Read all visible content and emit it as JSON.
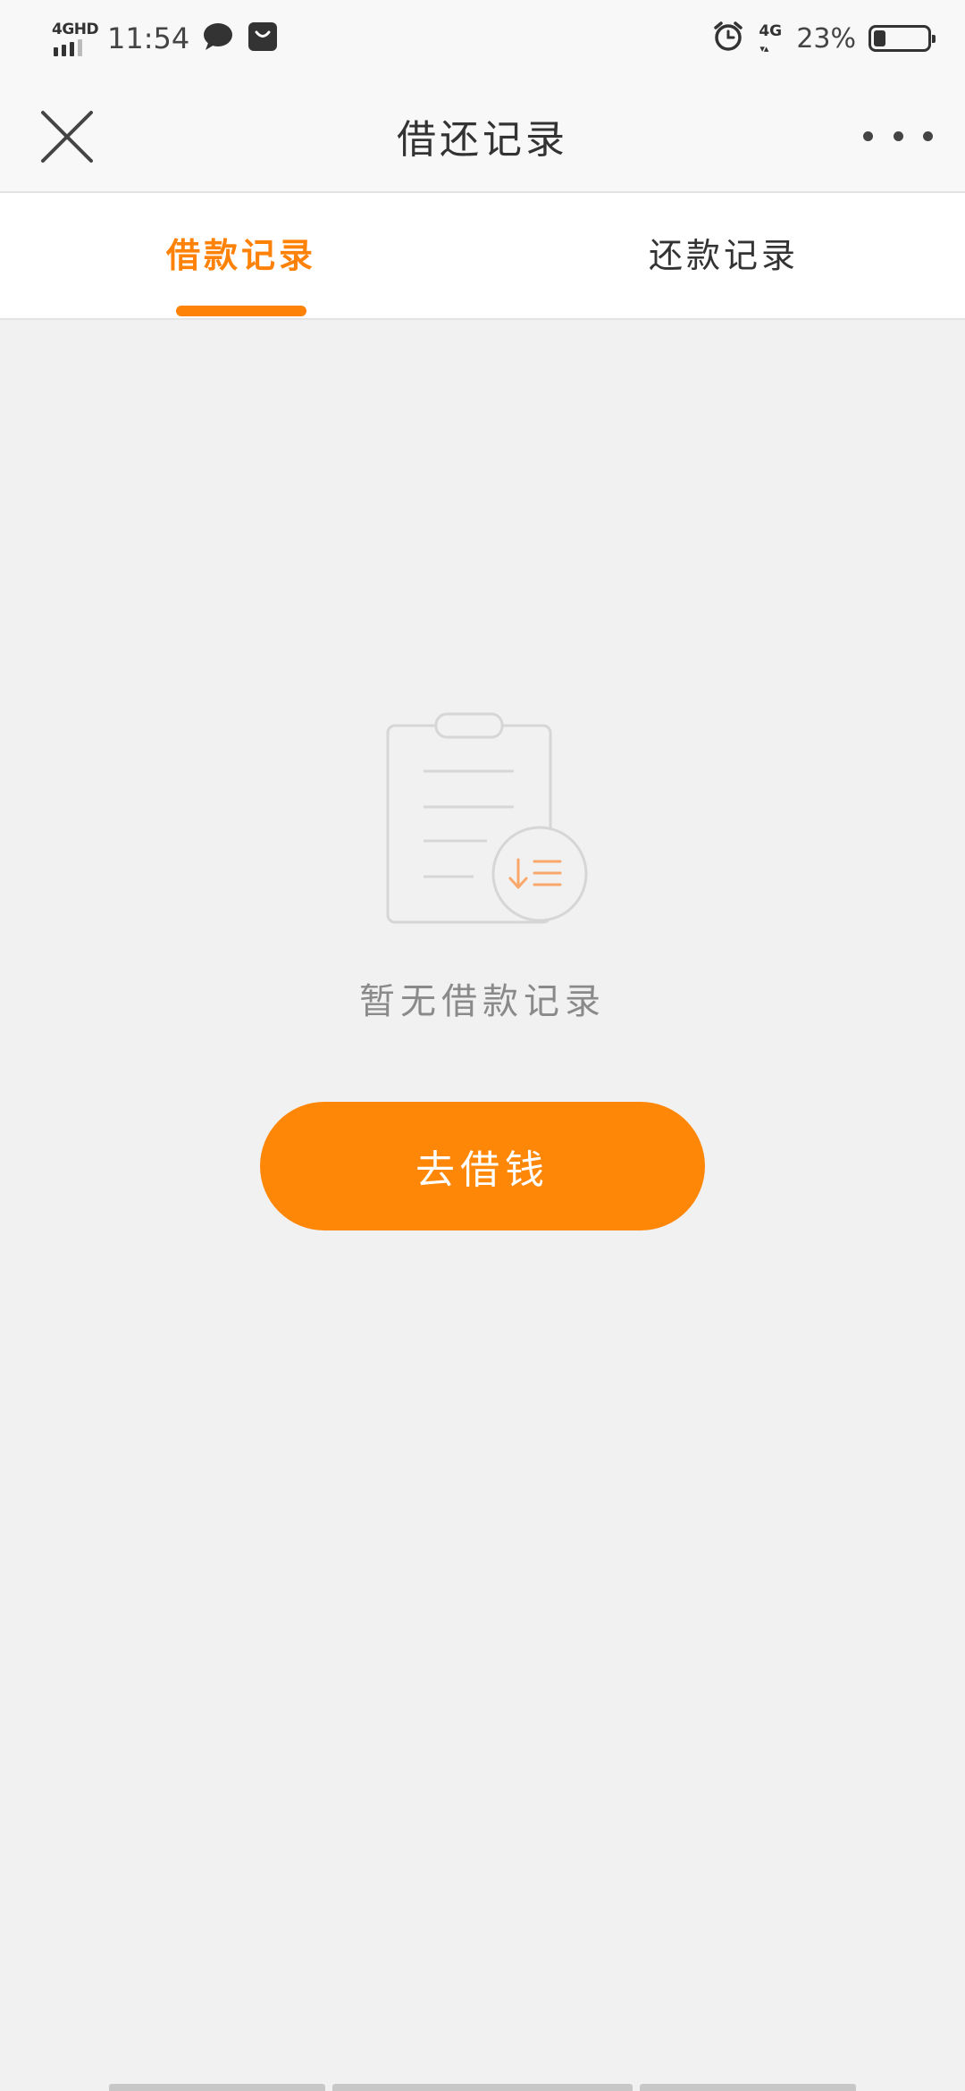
{
  "status_bar": {
    "network_label": "4GHD",
    "time": "11:54",
    "mobile_data_label": "4G",
    "battery_percent": "23%",
    "battery_level": 0.23,
    "icons": [
      "signal-icon",
      "message-bubble-icon",
      "bag-icon",
      "alarm-icon",
      "battery-icon"
    ]
  },
  "nav": {
    "title": "借还记录",
    "close_icon": "close-icon",
    "more_icon": "more-icon"
  },
  "tabs": [
    {
      "label": "借款记录",
      "active": true
    },
    {
      "label": "还款记录",
      "active": false
    }
  ],
  "empty_state": {
    "illustration_icon": "clipboard-sort-icon",
    "message": "暂无借款记录",
    "button_label": "去借钱"
  },
  "colors": {
    "accent": "#ff8208",
    "background": "#f1f1f1",
    "tab_background": "#ffffff",
    "text_primary": "#333333",
    "text_muted": "#8a8a8a"
  }
}
